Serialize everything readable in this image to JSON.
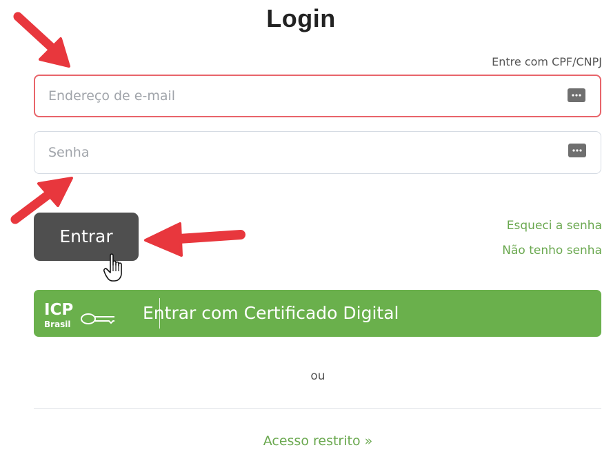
{
  "page": {
    "title": "Login",
    "cpf_link": "Entre com CPF/CNPJ"
  },
  "form": {
    "email_placeholder": "Endereço de e-mail",
    "email_value": "",
    "password_placeholder": "Senha",
    "password_value": "",
    "field_icon": "password-manager-dots-icon"
  },
  "actions": {
    "login_label": "Entrar",
    "forgot_password": "Esqueci a senha",
    "no_password": "Não tenho senha",
    "certificate_label": "Entrar com Certificado Digital",
    "certificate_logo": "ICP Brasil",
    "or_text": "ou",
    "restricted_access": "Acesso restrito »"
  },
  "annotations": {
    "arrow_color": "#e8373d",
    "cursor": "hand-pointer-icon"
  },
  "colors": {
    "accent_green": "#6ab04c",
    "link_green": "#6aa84f",
    "button_dark": "#4f4f4f",
    "error_border": "#e8646a"
  }
}
